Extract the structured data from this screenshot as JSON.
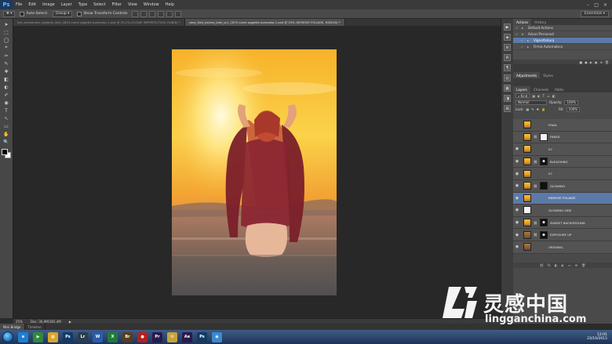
{
  "app": {
    "logo": "Ps"
  },
  "menu": [
    "File",
    "Edit",
    "Image",
    "Layer",
    "Type",
    "Select",
    "Filter",
    "View",
    "Window",
    "Help"
  ],
  "window_controls": [
    "–",
    "□",
    "×"
  ],
  "options": {
    "tool_icon": "move-icon",
    "auto_select_label": "Auto-Select:",
    "auto_select_value": "Group",
    "transform_label": "Show Transform Controls",
    "workspace": "Essentials"
  },
  "tabs": [
    {
      "label": "Set_alessandra_ingfolda_lake_0814 come oggetto avanzato-1.psd @ 25,2% (CLONE IMPERFECTION, RGB/8) *",
      "active": false
    },
    {
      "label": "cane_Sdd_oviana_lake_sc1_1875 come oggetto avanzato-1.psd @ 25% (REMOVE FOLIAGE, RGB/16) *",
      "active": true
    }
  ],
  "tools": [
    "➤",
    "⬚",
    "◯",
    "⌖",
    "✂",
    "✎",
    "✚",
    "◧",
    "◐",
    "✐",
    "◉",
    "T",
    "↖",
    "▭",
    "✋",
    "🔍"
  ],
  "status": {
    "zoom": "25%",
    "doc": "Doc: 36,9M/365,4M"
  },
  "bottom_tabs": [
    {
      "label": "Mini Bridge",
      "active": true
    },
    {
      "label": "Timeline",
      "active": false
    }
  ],
  "dock_icons": [
    "▶",
    "◈",
    "≡",
    "A",
    "¶",
    "◎",
    "▦",
    "◨",
    "⊞"
  ],
  "actions_panel": {
    "tabs": [
      {
        "label": "Actions",
        "active": true
      },
      {
        "label": "History",
        "active": false
      }
    ],
    "rows": [
      {
        "check": "✓",
        "toggle": "▸",
        "label": "Default Actions",
        "selected": false
      },
      {
        "check": "✓",
        "toggle": "▾",
        "label": "Azioni Personali",
        "selected": false
      },
      {
        "check": "✓",
        "toggle": "▸",
        "label": "Vignettatura",
        "selected": true
      },
      {
        "check": "✓",
        "toggle": "▸",
        "label": "Firma Automatica",
        "selected": false
      }
    ],
    "toolbar_icons": [
      "■",
      "●",
      "▶",
      "▣",
      "⊕",
      "🗑"
    ]
  },
  "adjust_tabs": [
    {
      "label": "Adjustments",
      "active": true
    },
    {
      "label": "Styles",
      "active": false
    }
  ],
  "layers_panel": {
    "tabs": [
      {
        "label": "Layers",
        "active": true
      },
      {
        "label": "Channels",
        "active": false
      },
      {
        "label": "Paths",
        "active": false
      }
    ],
    "filter_kind": "Kind",
    "blend_mode": "Normal",
    "opacity_label": "Opacity:",
    "opacity_value": "100%",
    "lock_label": "Lock:",
    "fill_label": "Fill:",
    "fill_value": "100%",
    "layers": [
      {
        "name": "FINAL",
        "eye": false,
        "thumb": "sun",
        "mask": null,
        "selected": false
      },
      {
        "name": "FAKED",
        "eye": false,
        "thumb": "sun",
        "mask": "white",
        "selected": false
      },
      {
        "name": "07",
        "eye": true,
        "thumb": "sun",
        "mask": null,
        "selected": false
      },
      {
        "name": "BLEACHING",
        "eye": true,
        "thumb": "sun",
        "mask": "mask",
        "selected": false
      },
      {
        "name": "07",
        "eye": true,
        "thumb": "sun",
        "mask": null,
        "selected": false
      },
      {
        "name": "GLOWING",
        "eye": true,
        "thumb": "sun",
        "mask": "black",
        "selected": false
      },
      {
        "name": "REMOVE FOLIAGE",
        "eye": true,
        "thumb": "sun",
        "mask": null,
        "selected": true
      },
      {
        "name": "GLOWING SIDE",
        "eye": true,
        "thumb": "white",
        "mask": null,
        "selected": false
      },
      {
        "name": "SUNSET BACKGROUND",
        "eye": true,
        "thumb": "sun",
        "mask": "mask",
        "selected": false
      },
      {
        "name": "EXPOSURE UP",
        "eye": true,
        "thumb": "grad",
        "mask": "mask",
        "selected": false
      },
      {
        "name": "ORIGINAL",
        "eye": true,
        "thumb": "grad",
        "mask": null,
        "selected": false
      }
    ],
    "footer_icons": [
      "⛓",
      "fx",
      "◧",
      "◐",
      "▭",
      "⊞",
      "🗑"
    ]
  },
  "taskbar": {
    "apps": [
      {
        "label": "e",
        "color": "#1d7fd1"
      },
      {
        "label": "▶",
        "color": "#2f8a3a"
      },
      {
        "label": "▦",
        "color": "#d9a62a"
      },
      {
        "label": "Ps",
        "color": "#123a66"
      },
      {
        "label": "Lr",
        "color": "#2b3c4d"
      },
      {
        "label": "W",
        "color": "#2a5db0"
      },
      {
        "label": "X",
        "color": "#1f7a3a"
      },
      {
        "label": "Br",
        "color": "#5a3c1a"
      },
      {
        "label": "●",
        "color": "#b32020"
      },
      {
        "label": "Pr",
        "color": "#2a1a4d"
      },
      {
        "label": "✉",
        "color": "#c7a23a"
      },
      {
        "label": "Ae",
        "color": "#2a1a4d"
      },
      {
        "label": "Ps",
        "color": "#123a66"
      },
      {
        "label": "◉",
        "color": "#3a8ad0"
      }
    ],
    "time": "12:01",
    "date": "23/10/2015"
  },
  "watermark": {
    "chinese": "灵感中国",
    "url": "lingganchina.com"
  }
}
